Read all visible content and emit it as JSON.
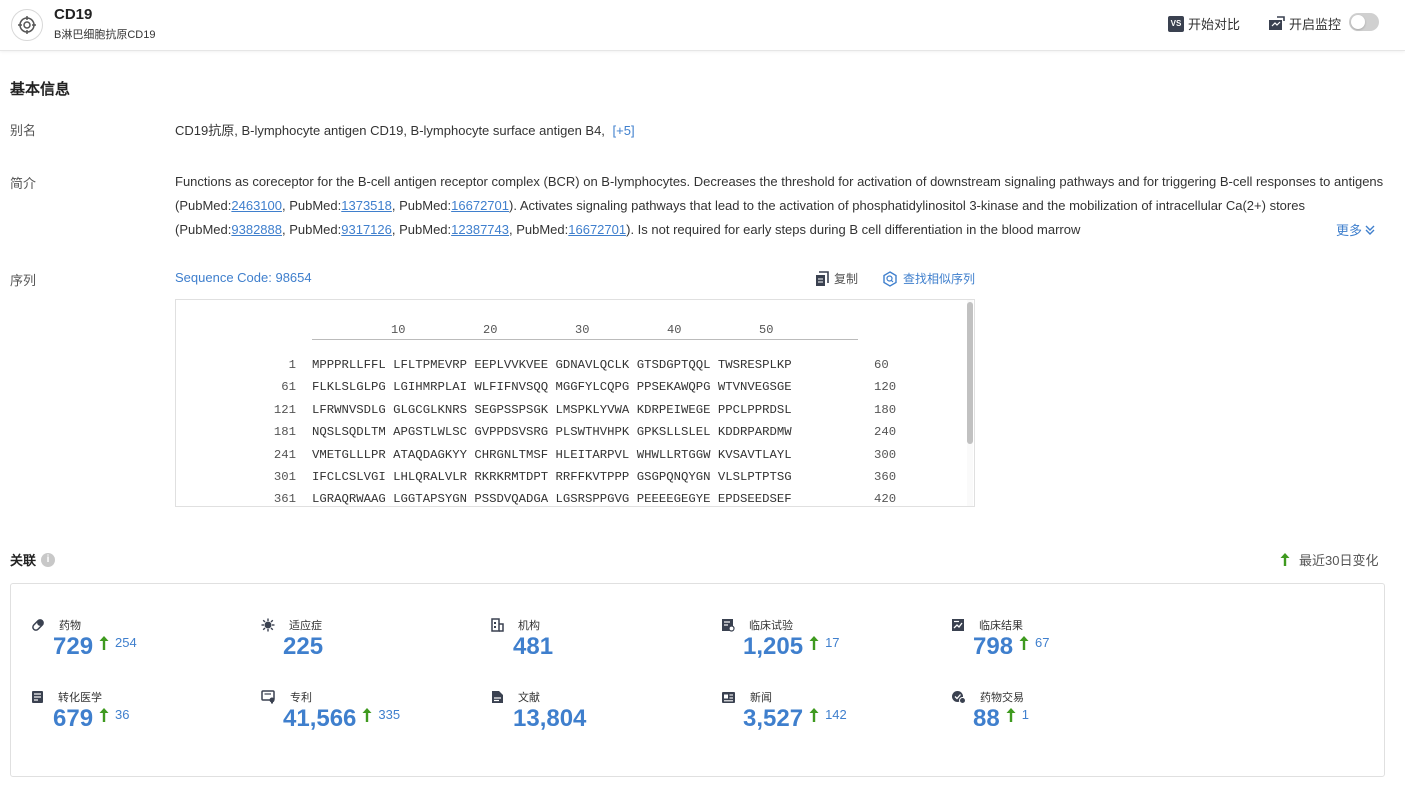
{
  "header": {
    "title": "CD19",
    "subtitle": "B淋巴细胞抗原CD19",
    "compare_label": "开始对比",
    "monitor_label": "开启监控",
    "compare_badge": "VS"
  },
  "basic": {
    "section_title": "基本信息",
    "alias_label": "别名",
    "alias_value": "CD19抗原,  B-lymphocyte antigen CD19,  B-lymphocyte surface antigen B4,",
    "alias_more": "[+5]",
    "intro_label": "简介",
    "intro": {
      "t1": "Functions as coreceptor for the B-cell antigen receptor complex (BCR) on B-lymphocytes. Decreases the threshold for activation of downstream signaling pathways and for triggering B-cell responses to antigens (PubMed:",
      "p1": "2463100",
      "t2": ", PubMed:",
      "p2": "1373518",
      "t3": ", PubMed:",
      "p3": "16672701",
      "t4": "). Activates signaling pathways that lead to the activation of phosphatidylinositol 3-kinase and the mobilization of intracellular Ca(2+) stores (PubMed:",
      "p4": "9382888",
      "t5": ", PubMed:",
      "p5": "9317126",
      "t6": ", PubMed:",
      "p6": "12387743",
      "t7": ", PubMed:",
      "p7": "16672701",
      "t8": "). Is not required for early steps during B cell differentiation in the blood marrow"
    },
    "more_label": "更多",
    "seq_label": "序列",
    "seq_code": "Sequence Code: 98654",
    "copy_label": "复制",
    "find_similar_label": "查找相似序列"
  },
  "sequence": {
    "ruler": [
      "10",
      "20",
      "30",
      "40",
      "50"
    ],
    "rows": [
      {
        "start": "1",
        "residues": "MPPPRLLFFL LFLTPMEVRP EEPLVVKVEE GDNAVLQCLK GTSDGPTQQL TWSRESPLKP",
        "end": "60"
      },
      {
        "start": "61",
        "residues": "FLKLSLGLPG LGIHMRPLAI WLFIFNVSQQ MGGFYLCQPG PPSEKAWQPG WTVNVEGSGE",
        "end": "120"
      },
      {
        "start": "121",
        "residues": "LFRWNVSDLG GLGCGLKNRS SEGPSSPSGK LMSPKLYVWA KDRPEIWEGE PPCLPPRDSL",
        "end": "180"
      },
      {
        "start": "181",
        "residues": "NQSLSQDLTM APGSTLWLSC GVPPDSVSRG PLSWTHVHPK GPKSLLSLEL KDDRPARDMW",
        "end": "240"
      },
      {
        "start": "241",
        "residues": "VMETGLLLPR ATAQDAGKYY CHRGNLTMSF HLEITARPVL WHWLLRTGGW KVSAVTLAYL",
        "end": "300"
      },
      {
        "start": "301",
        "residues": "IFCLCSLVGI LHLQRALVLR RKRKRMTDPT RRFFKVTPPP GSGPQNQYGN VLSLPTPTSG",
        "end": "360"
      },
      {
        "start": "361",
        "residues": "LGRAQRWAAG LGGTAPSYGN PSSDVQADGA LGSRSPPGVG PEEEEGEGYE EPDSEEDSEF",
        "end": "420"
      }
    ]
  },
  "association": {
    "title": "关联",
    "info_icon": "i",
    "recent_label": "最近30日变化",
    "stats": [
      {
        "label": "药物",
        "value": "729",
        "delta": "254",
        "icon": "pill-icon"
      },
      {
        "label": "适应症",
        "value": "225",
        "delta": "",
        "icon": "virus-icon"
      },
      {
        "label": "机构",
        "value": "481",
        "delta": "",
        "icon": "building-icon"
      },
      {
        "label": "临床试验",
        "value": "1,205",
        "delta": "17",
        "icon": "clinical-trial-icon"
      },
      {
        "label": "临床结果",
        "value": "798",
        "delta": "67",
        "icon": "clinical-result-icon"
      },
      {
        "label": "转化医学",
        "value": "679",
        "delta": "36",
        "icon": "translational-icon"
      },
      {
        "label": "专利",
        "value": "41,566",
        "delta": "335",
        "icon": "patent-icon"
      },
      {
        "label": "文献",
        "value": "13,804",
        "delta": "",
        "icon": "literature-icon"
      },
      {
        "label": "新闻",
        "value": "3,527",
        "delta": "142",
        "icon": "news-icon"
      },
      {
        "label": "药物交易",
        "value": "88",
        "delta": "1",
        "icon": "deal-icon"
      }
    ]
  },
  "colors": {
    "accent": "#3f7fcd",
    "up_arrow": "#3f9a1f"
  }
}
